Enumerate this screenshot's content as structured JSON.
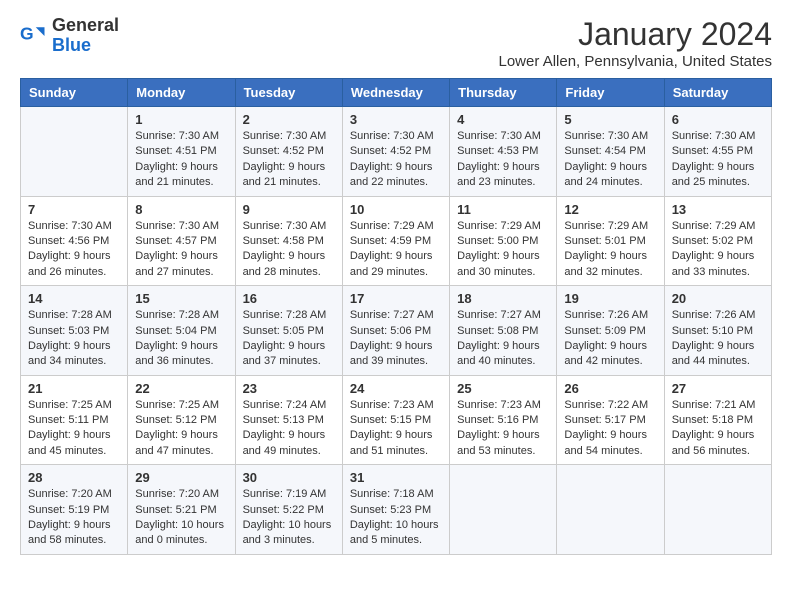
{
  "logo": {
    "general": "General",
    "blue": "Blue"
  },
  "header": {
    "month": "January 2024",
    "location": "Lower Allen, Pennsylvania, United States"
  },
  "days": [
    "Sunday",
    "Monday",
    "Tuesday",
    "Wednesday",
    "Thursday",
    "Friday",
    "Saturday"
  ],
  "weeks": [
    [
      {
        "day": "",
        "info": ""
      },
      {
        "day": "1",
        "info": "Sunrise: 7:30 AM\nSunset: 4:51 PM\nDaylight: 9 hours\nand 21 minutes."
      },
      {
        "day": "2",
        "info": "Sunrise: 7:30 AM\nSunset: 4:52 PM\nDaylight: 9 hours\nand 21 minutes."
      },
      {
        "day": "3",
        "info": "Sunrise: 7:30 AM\nSunset: 4:52 PM\nDaylight: 9 hours\nand 22 minutes."
      },
      {
        "day": "4",
        "info": "Sunrise: 7:30 AM\nSunset: 4:53 PM\nDaylight: 9 hours\nand 23 minutes."
      },
      {
        "day": "5",
        "info": "Sunrise: 7:30 AM\nSunset: 4:54 PM\nDaylight: 9 hours\nand 24 minutes."
      },
      {
        "day": "6",
        "info": "Sunrise: 7:30 AM\nSunset: 4:55 PM\nDaylight: 9 hours\nand 25 minutes."
      }
    ],
    [
      {
        "day": "7",
        "info": "Sunrise: 7:30 AM\nSunset: 4:56 PM\nDaylight: 9 hours\nand 26 minutes."
      },
      {
        "day": "8",
        "info": "Sunrise: 7:30 AM\nSunset: 4:57 PM\nDaylight: 9 hours\nand 27 minutes."
      },
      {
        "day": "9",
        "info": "Sunrise: 7:30 AM\nSunset: 4:58 PM\nDaylight: 9 hours\nand 28 minutes."
      },
      {
        "day": "10",
        "info": "Sunrise: 7:29 AM\nSunset: 4:59 PM\nDaylight: 9 hours\nand 29 minutes."
      },
      {
        "day": "11",
        "info": "Sunrise: 7:29 AM\nSunset: 5:00 PM\nDaylight: 9 hours\nand 30 minutes."
      },
      {
        "day": "12",
        "info": "Sunrise: 7:29 AM\nSunset: 5:01 PM\nDaylight: 9 hours\nand 32 minutes."
      },
      {
        "day": "13",
        "info": "Sunrise: 7:29 AM\nSunset: 5:02 PM\nDaylight: 9 hours\nand 33 minutes."
      }
    ],
    [
      {
        "day": "14",
        "info": "Sunrise: 7:28 AM\nSunset: 5:03 PM\nDaylight: 9 hours\nand 34 minutes."
      },
      {
        "day": "15",
        "info": "Sunrise: 7:28 AM\nSunset: 5:04 PM\nDaylight: 9 hours\nand 36 minutes."
      },
      {
        "day": "16",
        "info": "Sunrise: 7:28 AM\nSunset: 5:05 PM\nDaylight: 9 hours\nand 37 minutes."
      },
      {
        "day": "17",
        "info": "Sunrise: 7:27 AM\nSunset: 5:06 PM\nDaylight: 9 hours\nand 39 minutes."
      },
      {
        "day": "18",
        "info": "Sunrise: 7:27 AM\nSunset: 5:08 PM\nDaylight: 9 hours\nand 40 minutes."
      },
      {
        "day": "19",
        "info": "Sunrise: 7:26 AM\nSunset: 5:09 PM\nDaylight: 9 hours\nand 42 minutes."
      },
      {
        "day": "20",
        "info": "Sunrise: 7:26 AM\nSunset: 5:10 PM\nDaylight: 9 hours\nand 44 minutes."
      }
    ],
    [
      {
        "day": "21",
        "info": "Sunrise: 7:25 AM\nSunset: 5:11 PM\nDaylight: 9 hours\nand 45 minutes."
      },
      {
        "day": "22",
        "info": "Sunrise: 7:25 AM\nSunset: 5:12 PM\nDaylight: 9 hours\nand 47 minutes."
      },
      {
        "day": "23",
        "info": "Sunrise: 7:24 AM\nSunset: 5:13 PM\nDaylight: 9 hours\nand 49 minutes."
      },
      {
        "day": "24",
        "info": "Sunrise: 7:23 AM\nSunset: 5:15 PM\nDaylight: 9 hours\nand 51 minutes."
      },
      {
        "day": "25",
        "info": "Sunrise: 7:23 AM\nSunset: 5:16 PM\nDaylight: 9 hours\nand 53 minutes."
      },
      {
        "day": "26",
        "info": "Sunrise: 7:22 AM\nSunset: 5:17 PM\nDaylight: 9 hours\nand 54 minutes."
      },
      {
        "day": "27",
        "info": "Sunrise: 7:21 AM\nSunset: 5:18 PM\nDaylight: 9 hours\nand 56 minutes."
      }
    ],
    [
      {
        "day": "28",
        "info": "Sunrise: 7:20 AM\nSunset: 5:19 PM\nDaylight: 9 hours\nand 58 minutes."
      },
      {
        "day": "29",
        "info": "Sunrise: 7:20 AM\nSunset: 5:21 PM\nDaylight: 10 hours\nand 0 minutes."
      },
      {
        "day": "30",
        "info": "Sunrise: 7:19 AM\nSunset: 5:22 PM\nDaylight: 10 hours\nand 3 minutes."
      },
      {
        "day": "31",
        "info": "Sunrise: 7:18 AM\nSunset: 5:23 PM\nDaylight: 10 hours\nand 5 minutes."
      },
      {
        "day": "",
        "info": ""
      },
      {
        "day": "",
        "info": ""
      },
      {
        "day": "",
        "info": ""
      }
    ]
  ]
}
